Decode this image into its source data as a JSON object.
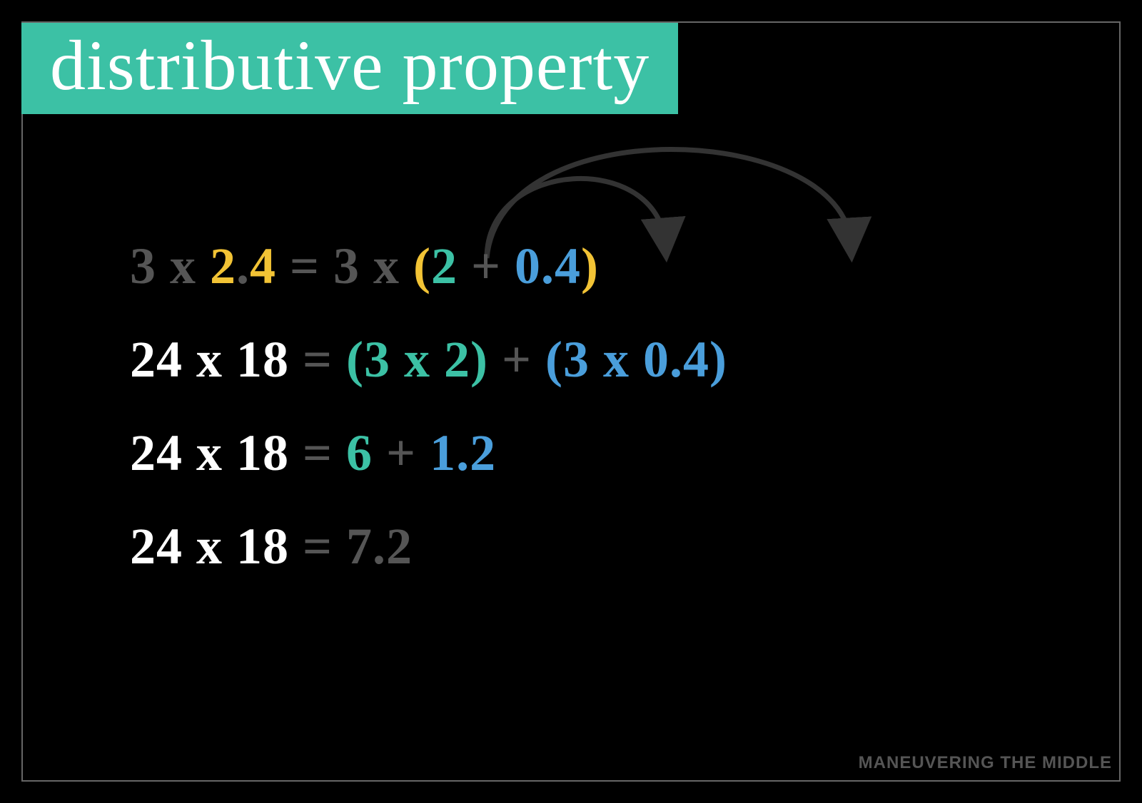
{
  "title": "distributive property",
  "watermark": "MANEUVERING THE MIDDLE",
  "colors": {
    "white": "#ffffff",
    "gray": "#555555",
    "yellow": "#f2c335",
    "teal": "#3cc1a5",
    "blue": "#4a9edb",
    "bg": "#000000"
  },
  "lines": [
    {
      "tokens": [
        {
          "text": "3 x ",
          "color": "gray"
        },
        {
          "text": "2",
          "color": "yellow"
        },
        {
          "text": ".",
          "color": "gray"
        },
        {
          "text": "4",
          "color": "yellow"
        },
        {
          "text": " = ",
          "color": "gray"
        },
        {
          "text": "3 ",
          "color": "gray"
        },
        {
          "text": "x ",
          "color": "gray"
        },
        {
          "text": "(",
          "color": "yellow"
        },
        {
          "text": "2",
          "color": "teal"
        },
        {
          "text": " + ",
          "color": "gray"
        },
        {
          "text": "0.4",
          "color": "blue"
        },
        {
          "text": ")",
          "color": "yellow"
        }
      ]
    },
    {
      "tokens": [
        {
          "text": "24 x 18 ",
          "color": "white"
        },
        {
          "text": "= ",
          "color": "gray"
        },
        {
          "text": "(3 x 2)",
          "color": "teal"
        },
        {
          "text": " + ",
          "color": "gray"
        },
        {
          "text": "(3 x 0.4)",
          "color": "blue"
        }
      ]
    },
    {
      "tokens": [
        {
          "text": "24 x 18 ",
          "color": "white"
        },
        {
          "text": "= ",
          "color": "gray"
        },
        {
          "text": "6",
          "color": "teal"
        },
        {
          "text": " + ",
          "color": "gray"
        },
        {
          "text": "1.2",
          "color": "blue"
        }
      ]
    },
    {
      "tokens": [
        {
          "text": "24 x 18 ",
          "color": "white"
        },
        {
          "text": "= ",
          "color": "gray"
        },
        {
          "text": "7.2",
          "color": "gray"
        }
      ]
    }
  ]
}
